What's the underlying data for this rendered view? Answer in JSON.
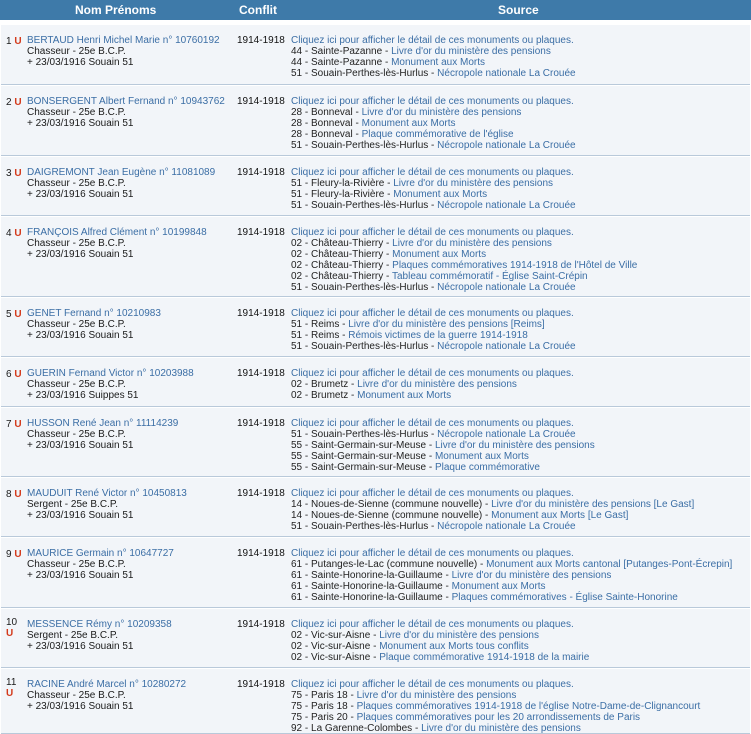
{
  "headers": {
    "name": "Nom Prénoms",
    "conflict": "Conflit",
    "source": "Source"
  },
  "colors": {
    "header_bg": "#3e7aa9",
    "row_bg": "#f2f5f9",
    "link": "#3b6ea5",
    "badge": "#d33a1b"
  },
  "rows": [
    {
      "num": "1",
      "badge": "U",
      "name": "BERTAUD Henri Michel Marie n° 10760192",
      "rank": "Chasseur - 25e B.C.P.",
      "death": "+ 23/03/1916 Souain 51",
      "conflict": "1914-1918",
      "details": "Cliquez ici pour afficher le détail de ces monuments ou plaques.",
      "sources": [
        [
          "44 - Sainte-Pazanne - ",
          "Livre d'or du ministère des pensions"
        ],
        [
          "44 - Sainte-Pazanne - ",
          "Monument aux Morts"
        ],
        [
          "51 - Souain-Perthes-lès-Hurlus - ",
          "Nécropole nationale La Crouée"
        ]
      ]
    },
    {
      "num": "2",
      "badge": "U",
      "name": "BONSERGENT Albert Fernand n° 10943762",
      "rank": "Chasseur - 25e B.C.P.",
      "death": "+ 23/03/1916 Souain 51",
      "conflict": "1914-1918",
      "details": "Cliquez ici pour afficher le détail de ces monuments ou plaques.",
      "sources": [
        [
          "28 - Bonneval - ",
          "Livre d'or du ministère des pensions"
        ],
        [
          "28 - Bonneval - ",
          "Monument aux Morts"
        ],
        [
          "28 - Bonneval - ",
          "Plaque commémorative de l'église"
        ],
        [
          "51 - Souain-Perthes-lès-Hurlus - ",
          "Nécropole nationale La Crouée"
        ]
      ]
    },
    {
      "num": "3",
      "badge": "U",
      "name": "DAIGREMONT Jean Eugène n° 11081089",
      "rank": "Chasseur - 25e B.C.P.",
      "death": "+ 23/03/1916 Souain 51",
      "conflict": "1914-1918",
      "details": "Cliquez ici pour afficher le détail de ces monuments ou plaques.",
      "sources": [
        [
          "51 - Fleury-la-Rivière - ",
          "Livre d'or du ministère des pensions"
        ],
        [
          "51 - Fleury-la-Rivière - ",
          "Monument aux Morts"
        ],
        [
          "51 - Souain-Perthes-lès-Hurlus - ",
          "Nécropole nationale La Crouée"
        ]
      ]
    },
    {
      "num": "4",
      "badge": "U",
      "name": "FRANÇOIS Alfred Clément n° 10199848",
      "rank": "Chasseur - 25e B.C.P.",
      "death": "+ 23/03/1916 Souain 51",
      "conflict": "1914-1918",
      "details": "Cliquez ici pour afficher le détail de ces monuments ou plaques.",
      "sources": [
        [
          "02 - Château-Thierry - ",
          "Livre d'or du ministère des pensions"
        ],
        [
          "02 - Château-Thierry - ",
          "Monument aux Morts"
        ],
        [
          "02 - Château-Thierry - ",
          "Plaques commémoratives 1914-1918 de l'Hôtel de Ville"
        ],
        [
          "02 - Château-Thierry - ",
          "Tableau commémoratif - Église Saint-Crépin"
        ],
        [
          "51 - Souain-Perthes-lès-Hurlus - ",
          "Nécropole nationale La Crouée"
        ]
      ]
    },
    {
      "num": "5",
      "badge": "U",
      "name": "GENET Fernand n° 10210983",
      "rank": "Chasseur - 25e B.C.P.",
      "death": "+ 23/03/1916 Souain 51",
      "conflict": "1914-1918",
      "details": "Cliquez ici pour afficher le détail de ces monuments ou plaques.",
      "sources": [
        [
          "51 - Reims - ",
          "Livre d'or du ministère des pensions [Reims]"
        ],
        [
          "51 - Reims - ",
          "Rémois victimes de la guerre 1914-1918"
        ],
        [
          "51 - Souain-Perthes-lès-Hurlus - ",
          "Nécropole nationale La Crouée"
        ]
      ]
    },
    {
      "num": "6",
      "badge": "U",
      "name": "GUERIN Fernand Victor n° 10203988",
      "rank": "Chasseur - 25e B.C.P.",
      "death": "+ 23/03/1916 Suippes 51",
      "conflict": "1914-1918",
      "details": "Cliquez ici pour afficher le détail de ces monuments ou plaques.",
      "sources": [
        [
          "02 - Brumetz - ",
          "Livre d'or du ministère des pensions"
        ],
        [
          "02 - Brumetz - ",
          "Monument aux Morts"
        ]
      ]
    },
    {
      "num": "7",
      "badge": "U",
      "name": "HUSSON René Jean n° 11114239",
      "rank": "Chasseur - 25e B.C.P.",
      "death": "+ 23/03/1916 Souain 51",
      "conflict": "1914-1918",
      "details": "Cliquez ici pour afficher le détail de ces monuments ou plaques.",
      "sources": [
        [
          "51 - Souain-Perthes-lès-Hurlus - ",
          "Nécropole nationale La Crouée"
        ],
        [
          "55 - Saint-Germain-sur-Meuse - ",
          "Livre d'or du ministère des pensions"
        ],
        [
          "55 - Saint-Germain-sur-Meuse - ",
          "Monument aux Morts"
        ],
        [
          "55 - Saint-Germain-sur-Meuse - ",
          "Plaque commémorative"
        ]
      ]
    },
    {
      "num": "8",
      "badge": "U",
      "name": "MAUDUIT René Victor n° 10450813",
      "rank": "Sergent - 25e B.C.P.",
      "death": "+ 23/03/1916 Souain 51",
      "conflict": "1914-1918",
      "details": "Cliquez ici pour afficher le détail de ces monuments ou plaques.",
      "sources": [
        [
          "14 - Noues-de-Sienne (commune nouvelle) - ",
          "Livre d'or du ministère des pensions [Le Gast]"
        ],
        [
          "14 - Noues-de-Sienne (commune nouvelle) - ",
          "Monument aux Morts [Le Gast]"
        ],
        [
          "51 - Souain-Perthes-lès-Hurlus - ",
          "Nécropole nationale La Crouée"
        ]
      ]
    },
    {
      "num": "9",
      "badge": "U",
      "name": "MAURICE Germain n° 10647727",
      "rank": "Chasseur - 25e B.C.P.",
      "death": "+ 23/03/1916 Souain 51",
      "conflict": "1914-1918",
      "details": "Cliquez ici pour afficher le détail de ces monuments ou plaques.",
      "sources": [
        [
          "61 - Putanges-le-Lac (commune nouvelle) - ",
          "Monument aux Morts cantonal [Putanges-Pont-Écrepin]"
        ],
        [
          "61 - Sainte-Honorine-la-Guillaume - ",
          "Livre d'or du ministère des pensions"
        ],
        [
          "61 - Sainte-Honorine-la-Guillaume - ",
          "Monument aux Morts"
        ],
        [
          "61 - Sainte-Honorine-la-Guillaume - ",
          "Plaques commémoratives - Église Sainte-Honorine"
        ]
      ]
    },
    {
      "num": "10",
      "badge": "U",
      "name": "MESSENCE Rémy n° 10209358",
      "rank": "Sergent - 25e B.C.P.",
      "death": "+ 23/03/1916 Souain 51",
      "conflict": "1914-1918",
      "details": "Cliquez ici pour afficher le détail de ces monuments ou plaques.",
      "sources": [
        [
          "02 - Vic-sur-Aisne - ",
          "Livre d'or du ministère des pensions"
        ],
        [
          "02 - Vic-sur-Aisne - ",
          "Monument aux Morts tous conflits"
        ],
        [
          "02 - Vic-sur-Aisne - ",
          "Plaque commémorative 1914-1918 de la mairie"
        ]
      ]
    },
    {
      "num": "11",
      "badge": "U",
      "name": "RACINE André Marcel n° 10280272",
      "rank": "Chasseur - 25e B.C.P.",
      "death": "+ 23/03/1916 Souain 51",
      "conflict": "1914-1918",
      "details": "Cliquez ici pour afficher le détail de ces monuments ou plaques.",
      "sources": [
        [
          "75 - Paris 18 - ",
          "Livre d'or du ministère des pensions"
        ],
        [
          "75 - Paris 18 - ",
          "Plaques commémoratives 1914-1918 de l'église Notre-Dame-de-Clignancourt"
        ],
        [
          "75 - Paris 20 - ",
          "Plaques commémoratives pour les 20 arrondissements de Paris"
        ],
        [
          "92 - La Garenne-Colombes - ",
          "Livre d'or du ministère des pensions"
        ]
      ]
    }
  ]
}
